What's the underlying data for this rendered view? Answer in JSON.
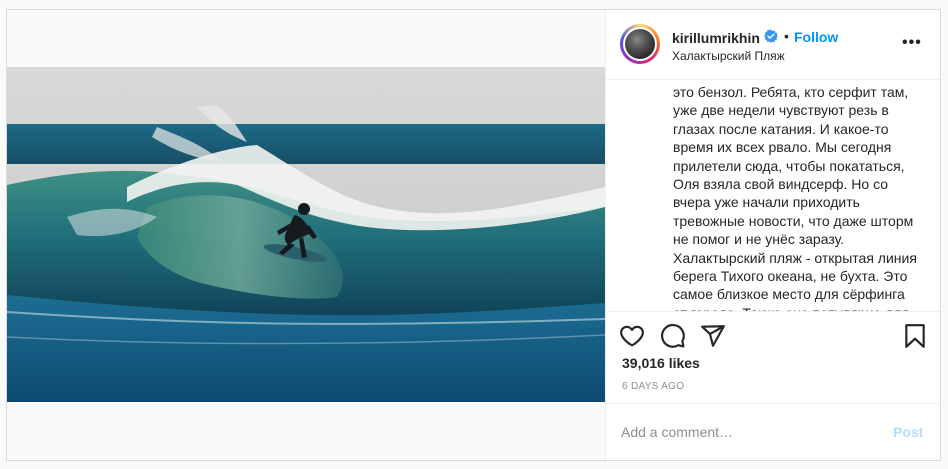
{
  "post": {
    "username": "kirillumrikhin",
    "verified_icon": "verified-badge-icon",
    "separator": "•",
    "follow_label": "Follow",
    "location": "Халактырский Пляж",
    "more_icon": "more-options-icon",
    "more_label": "•••",
    "caption": "это бензол. Ребята, кто серфит там,\nуже две недели чувствуют резь в\nглазах после катания. И какое-то\nвремя их всех рвало. Мы сегодня\nприлетели сюда, чтобы покататься,\nОля взяла свой виндсерф. Но со\nвчера уже начали приходить\nтревожные новости, что даже шторм\nне помог и не унёс заразу.\nХалактырский пляж - открытая линия\nберега Тихого океана, не бухта. Это\nсамое близкое место для сёрфинга\nот города. Также оно популярно для",
    "likes": "39,016 likes",
    "time": "6 DAYS AGO",
    "comment_placeholder": "Add a comment…",
    "post_label": "Post",
    "image": "surfer riding a barrel wave"
  },
  "icons": {
    "like": "heart-icon",
    "comment": "comment-icon",
    "share": "share-icon",
    "save": "bookmark-icon"
  },
  "colors": {
    "accent": "#0095f6",
    "post_disabled": "#b2dffc",
    "muted": "#8e8e8e",
    "text": "#262626"
  }
}
